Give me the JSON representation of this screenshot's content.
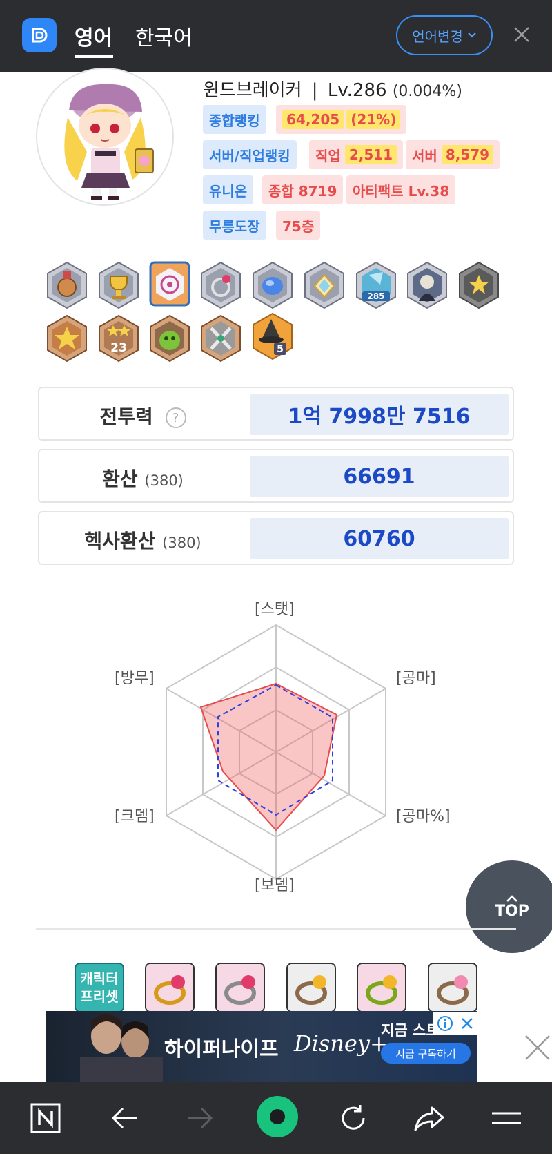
{
  "topbar": {
    "tab_english": "영어",
    "tab_korean": "한국어",
    "language_button": "언어변경"
  },
  "profile": {
    "job": "윈드브레이커",
    "separator": "|",
    "level": "Lv.286",
    "exp_percent": "(0.004%)",
    "overall_ranking_label": "종합랭킹",
    "overall_ranking_value": "64,205",
    "overall_ranking_pct": "(21%)",
    "server_job_ranking_label": "서버/직업랭킹",
    "job_rank_label": "직업",
    "job_rank_value": "2,511",
    "server_rank_label": "서버",
    "server_rank_value": "8,579",
    "union_label": "유니온",
    "union_total": "종합 8719",
    "artifact": "아티팩트 Lv.38",
    "dojo_label": "무릉도장",
    "dojo_floor": "75층"
  },
  "medals": {
    "badge_285": "285",
    "badge_23": "23",
    "badge_5": "5"
  },
  "stats": {
    "combat_power_label": "전투력",
    "combat_power_value": "1억 7998만 7516",
    "help_icon": "?",
    "conversion_label": "환산",
    "conversion_level": "(380)",
    "conversion_value": "66691",
    "hexa_label": "헥사환산",
    "hexa_level": "(380)",
    "hexa_value": "60760"
  },
  "radar": {
    "label_stat": "[스탯]",
    "label_attack": "[공마]",
    "label_attack_pct": "[공마%]",
    "label_boss": "[보뎀]",
    "label_crit": "[크뎀]",
    "label_ignore": "[방무]",
    "fill_color": "#f08a8a",
    "dashed_color": "#2f3fe0"
  },
  "top_button": {
    "label": "TOP"
  },
  "equipment": {
    "preset_label": "캐릭터 프리셋"
  },
  "ad": {
    "title": "하이퍼나이프",
    "brand": "Disney+",
    "now_streaming": "지금 스트",
    "subscribe": "지금 구독하기"
  }
}
